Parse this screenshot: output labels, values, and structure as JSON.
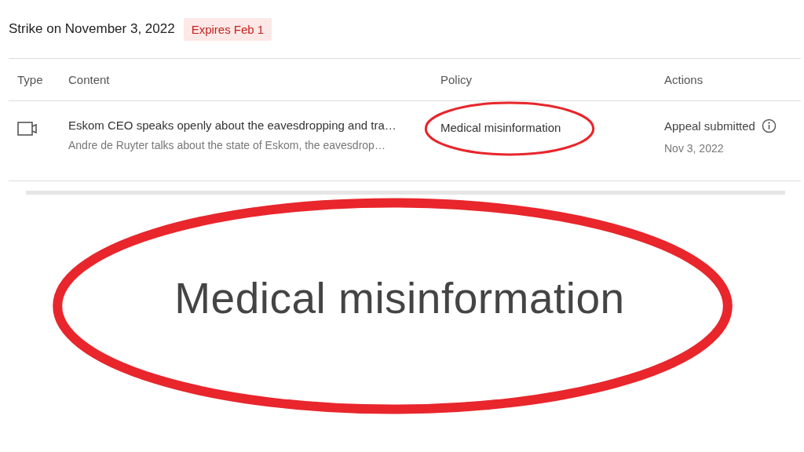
{
  "strike": {
    "title": "Strike on November 3, 2022",
    "badge": "Expires Feb 1"
  },
  "table": {
    "columns": [
      "Type",
      "Content",
      "Policy",
      "Actions"
    ],
    "rows": [
      {
        "kind": "video",
        "title": "Eskom CEO speaks openly about the eavesdropping and tra…",
        "description": "Andre de Ruyter talks about the state of Eskom, the eavesdrop…",
        "policy": "Medical misinformation",
        "action": "Appeal submitted",
        "date": "Nov 3, 2022"
      }
    ]
  },
  "zoom_callout": {
    "text": "Medical misinformation"
  }
}
